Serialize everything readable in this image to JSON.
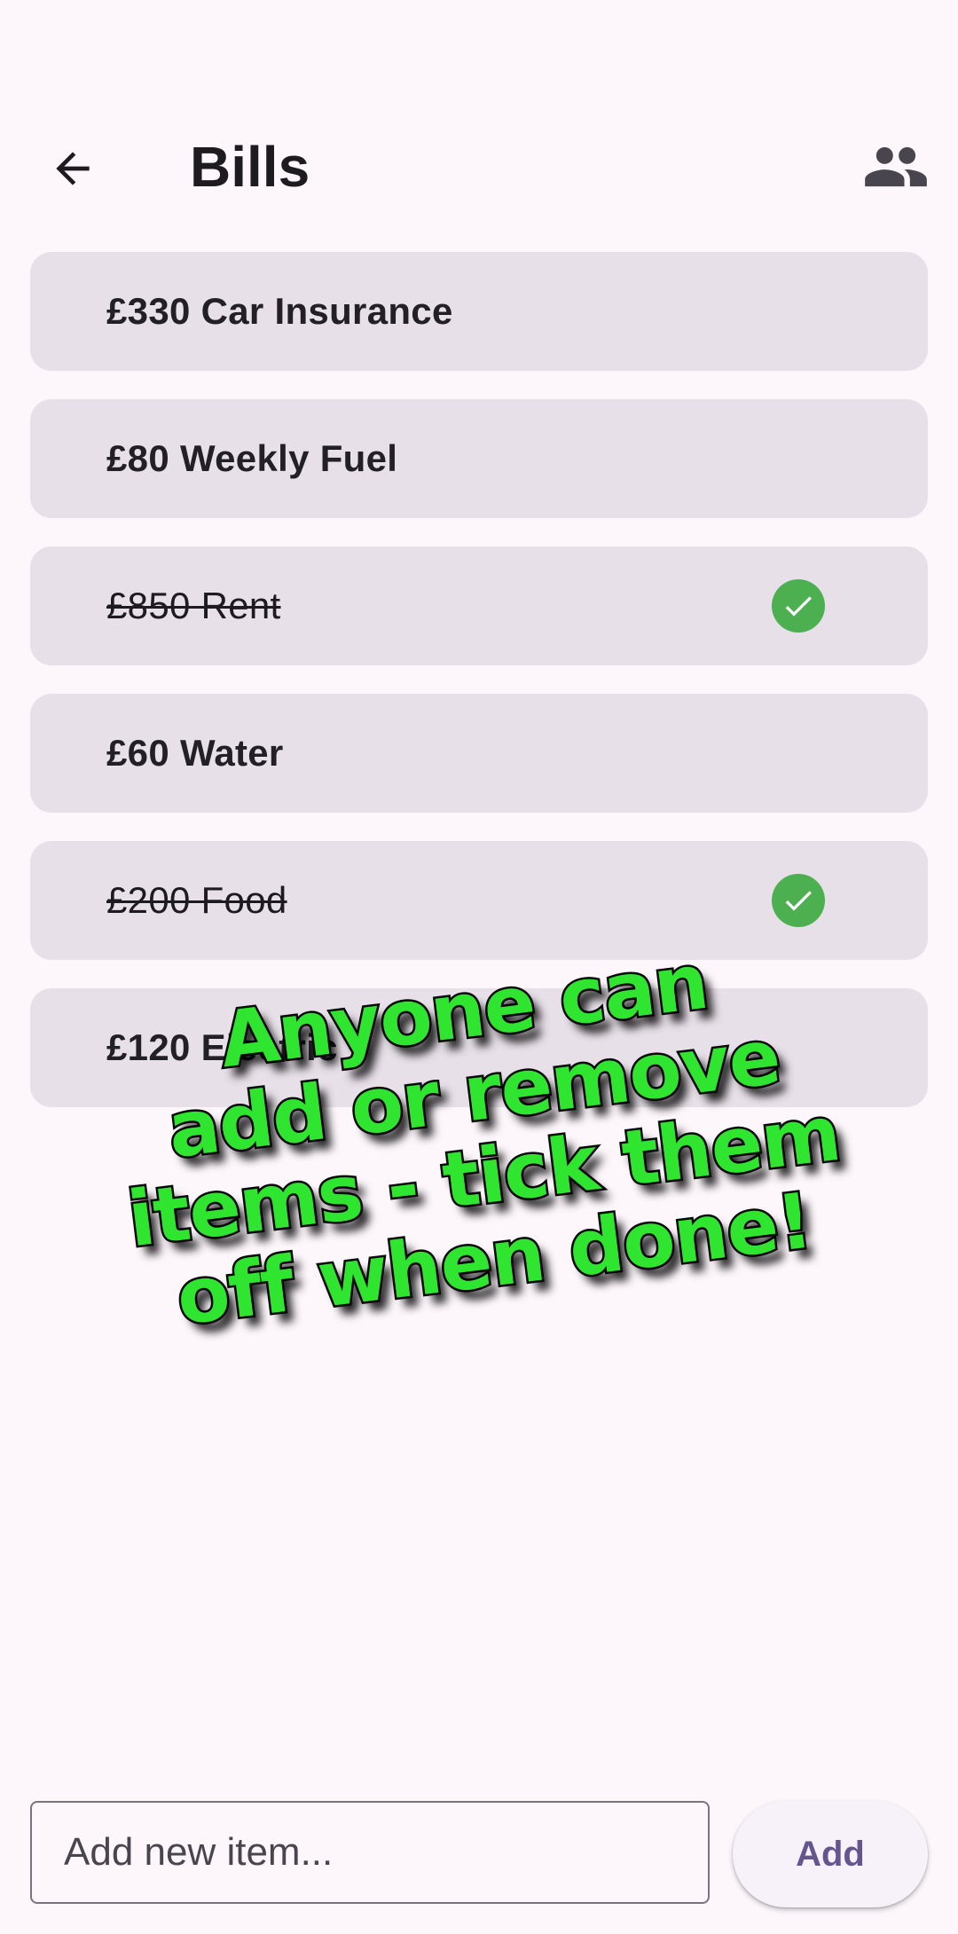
{
  "app_bar": {
    "title": "Bills",
    "back_icon": "arrow-back-icon",
    "people_icon": "people-icon"
  },
  "bills": [
    {
      "label": "£330 Car Insurance",
      "done": false
    },
    {
      "label": "£80 Weekly Fuel",
      "done": false
    },
    {
      "label": "£850 Rent",
      "done": true
    },
    {
      "label": "£60 Water",
      "done": false
    },
    {
      "label": "£200 Food",
      "done": true
    },
    {
      "label": "£120 Electric",
      "done": false
    }
  ],
  "promo": {
    "line1": "Anyone can",
    "line2": "add or remove",
    "line3": "items - tick them",
    "line4": "off when done!"
  },
  "composer": {
    "placeholder": "Add new item...",
    "value": "",
    "add_label": "Add"
  },
  "colors": {
    "background": "#fdf7fc",
    "card": "#e7e0e8",
    "check": "#4caf50",
    "accent": "#65558f",
    "promo_green": "#2fe52f"
  }
}
